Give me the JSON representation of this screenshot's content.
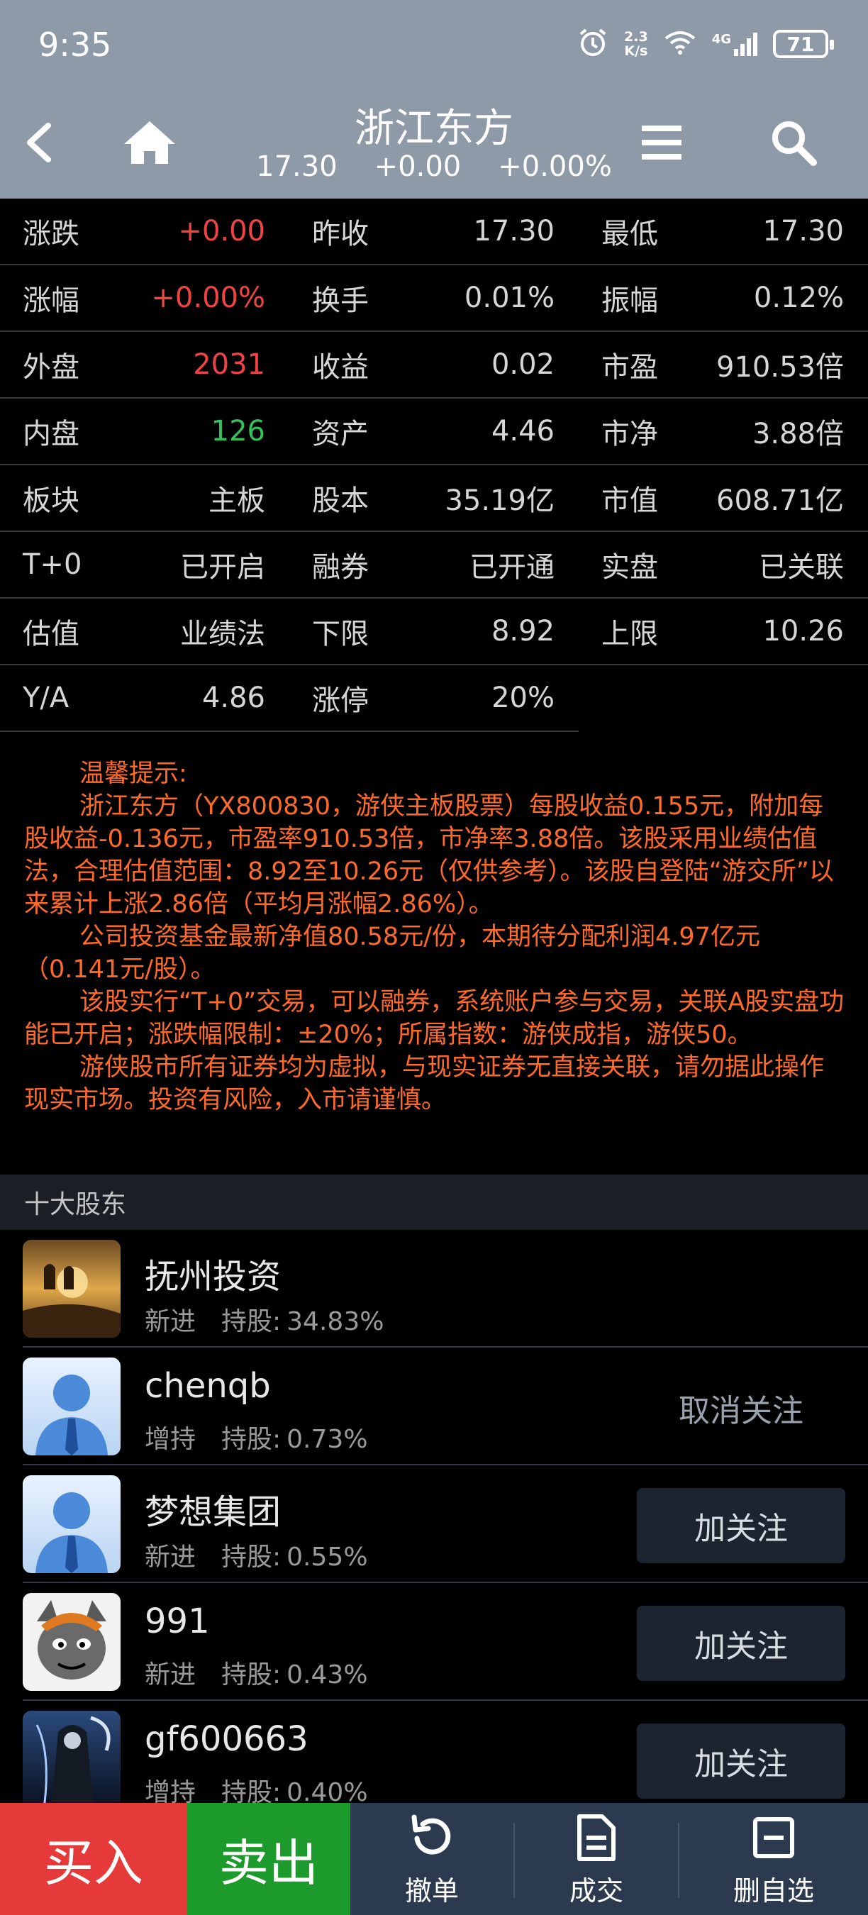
{
  "status_bar": {
    "time": "9:35",
    "net_speed_value": "2.3",
    "net_speed_unit": "K/s",
    "network": "4G",
    "battery": "71"
  },
  "header": {
    "title": "浙江东方",
    "price": "17.30",
    "change": "+0.00",
    "change_pct": "+0.00%"
  },
  "grid": [
    [
      {
        "label": "涨跌",
        "value": "+0.00",
        "color": "red"
      },
      {
        "label": "昨收",
        "value": "17.30"
      },
      {
        "label": "最低",
        "value": "17.30"
      }
    ],
    [
      {
        "label": "涨幅",
        "value": "+0.00%",
        "color": "red"
      },
      {
        "label": "换手",
        "value": "0.01%"
      },
      {
        "label": "振幅",
        "value": "0.12%"
      }
    ],
    [
      {
        "label": "外盘",
        "value": "2031",
        "color": "red"
      },
      {
        "label": "收益",
        "value": "0.02"
      },
      {
        "label": "市盈",
        "value": "910.53倍"
      }
    ],
    [
      {
        "label": "内盘",
        "value": "126",
        "color": "green"
      },
      {
        "label": "资产",
        "value": "4.46"
      },
      {
        "label": "市净",
        "value": "3.88倍"
      }
    ],
    [
      {
        "label": "板块",
        "value": "主板"
      },
      {
        "label": "股本",
        "value": "35.19亿"
      },
      {
        "label": "市值",
        "value": "608.71亿"
      }
    ],
    [
      {
        "label": "T+0",
        "value": "已开启"
      },
      {
        "label": "融券",
        "value": "已开通"
      },
      {
        "label": "实盘",
        "value": "已关联"
      }
    ],
    [
      {
        "label": "估值",
        "value": "业绩法"
      },
      {
        "label": "下限",
        "value": "8.92"
      },
      {
        "label": "上限",
        "value": "10.26"
      }
    ],
    [
      {
        "label": "Y/A",
        "value": "4.86"
      },
      {
        "label": "涨停",
        "value": "20%"
      }
    ]
  ],
  "notice": {
    "heading": "温馨提示:",
    "p1": "浙江东方（YX800830，游侠主板股票）每股收益0.155元，附加每股收益-0.136元，市盈率910.53倍，市净率3.88倍。该股采用业绩估值法，合理估值范围：8.92至10.26元（仅供参考）。该股自登陆“游交所”以来累计上涨2.86倍（平均月涨幅2.86%）。",
    "p2": "公司投资基金最新净值80.58元/份，本期待分配利润4.97亿元（0.141元/股）。",
    "p3": "该股实行“T+0”交易，可以融券，系统账户参与交易，关联A股实盘功能已开启；涨跌幅限制：±20%；所属指数：游侠成指，游侠50。",
    "p4": "游侠股市所有证券均为虚拟，与现实证券无直接关联，请勿据此操作现实市场。投资有风险，入市请谨慎。"
  },
  "shareholders": {
    "title": "十大股东",
    "hold_label": "持股:",
    "items": [
      {
        "name": "抚州投资",
        "status": "新进",
        "share": "34.83%",
        "avatar": "sunset-photo",
        "action": ""
      },
      {
        "name": "chenqb",
        "status": "增持",
        "share": "0.73%",
        "avatar": "default-user",
        "action": "取消关注"
      },
      {
        "name": "梦想集团",
        "status": "新进",
        "share": "0.55%",
        "avatar": "default-user",
        "action": "加关注"
      },
      {
        "name": "991",
        "status": "新进",
        "share": "0.43%",
        "avatar": "cartoon-wolf",
        "action": "加关注"
      },
      {
        "name": "gf600663",
        "status": "增持",
        "share": "0.40%",
        "avatar": "reaper-art",
        "action": "加关注"
      }
    ]
  },
  "bottom_bar": {
    "buy": "买入",
    "sell": "卖出",
    "cancel": "撤单",
    "deals": "成交",
    "remove": "删自选"
  },
  "colors": {
    "up": "#f04444",
    "down": "#33c25a",
    "header_bg": "#8e9aa8",
    "notice": "#ff6a2a",
    "bottom_bg": "#2b3a4e"
  }
}
